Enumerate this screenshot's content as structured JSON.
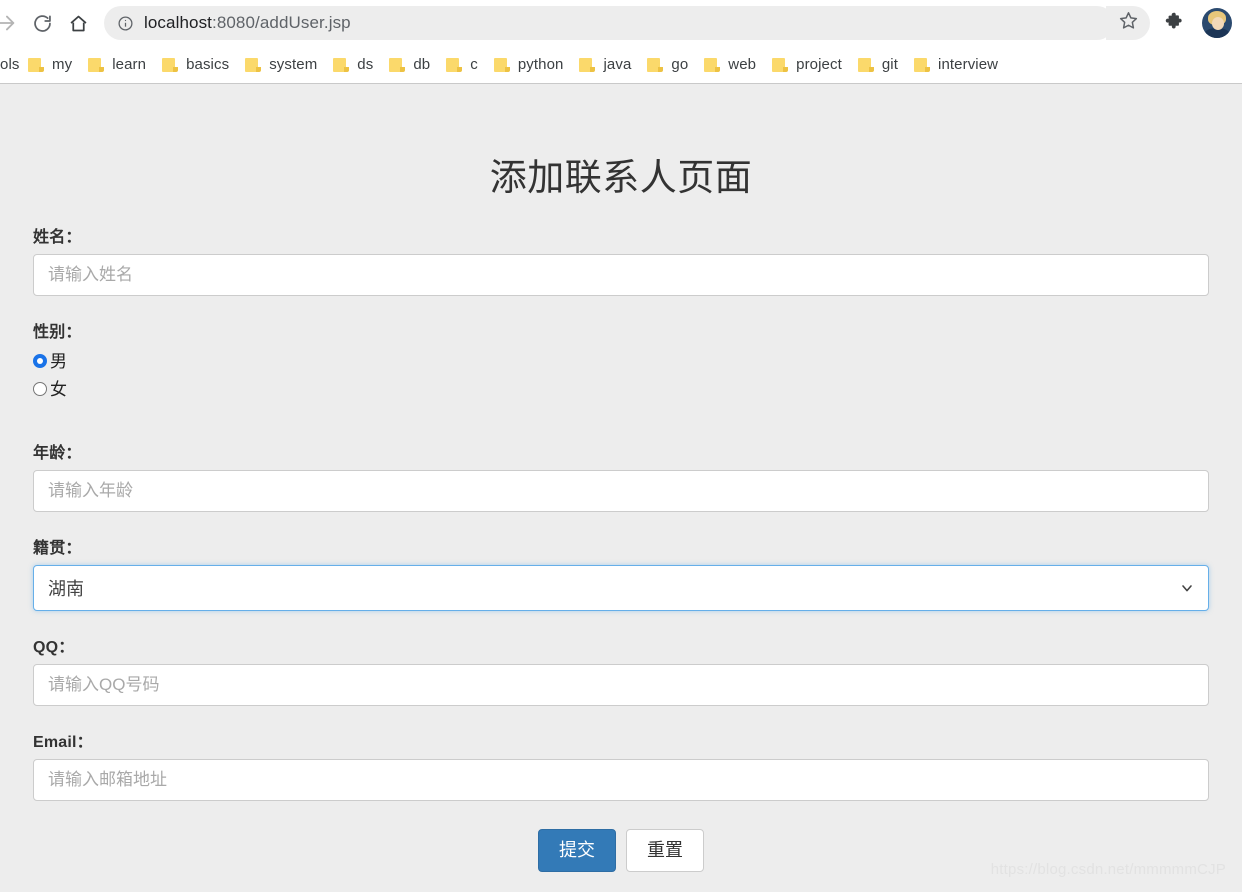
{
  "browser": {
    "nav": {
      "forward_icon": "arrow-forward-icon",
      "reload_icon": "reload-icon",
      "home_icon": "home-icon"
    },
    "omnibox": {
      "info_icon": "info-circle-icon",
      "url_host": "localhost",
      "url_rest": ":8080/addUser.jsp",
      "star_icon": "star-outline-icon"
    },
    "extensions_icon": "puzzle-piece-icon",
    "profile_icon": "profile-avatar",
    "bookmarks": [
      {
        "label": "ols",
        "icon": "folder-icon"
      },
      {
        "label": "my",
        "icon": "folder-icon"
      },
      {
        "label": "learn",
        "icon": "folder-icon"
      },
      {
        "label": "basics",
        "icon": "folder-icon"
      },
      {
        "label": "system",
        "icon": "folder-icon"
      },
      {
        "label": "ds",
        "icon": "folder-icon"
      },
      {
        "label": "db",
        "icon": "folder-icon"
      },
      {
        "label": "c",
        "icon": "folder-icon"
      },
      {
        "label": "python",
        "icon": "folder-icon"
      },
      {
        "label": "java",
        "icon": "folder-icon"
      },
      {
        "label": "go",
        "icon": "folder-icon"
      },
      {
        "label": "web",
        "icon": "folder-icon"
      },
      {
        "label": "project",
        "icon": "folder-icon"
      },
      {
        "label": "git",
        "icon": "folder-icon"
      },
      {
        "label": "interview",
        "icon": "folder-icon"
      }
    ]
  },
  "page": {
    "title": "添加联系人页面",
    "fields": {
      "name": {
        "label": "姓名：",
        "placeholder": "请输入姓名",
        "value": ""
      },
      "gender": {
        "label": "性别：",
        "options": [
          {
            "label": "男",
            "checked": true
          },
          {
            "label": "女",
            "checked": false
          }
        ]
      },
      "age": {
        "label": "年龄：",
        "placeholder": "请输入年龄",
        "value": ""
      },
      "hometown": {
        "label": "籍贯：",
        "selected": "湖南",
        "arrow_icon": "chevron-down-icon"
      },
      "qq": {
        "label": "QQ：",
        "placeholder": "请输入QQ号码",
        "value": ""
      },
      "email": {
        "label": "Email：",
        "placeholder": "请输入邮箱地址",
        "value": ""
      }
    },
    "buttons": {
      "submit": "提交",
      "reset": "重置"
    },
    "watermark": "https://blog.csdn.net/mmmmmCJP",
    "colors": {
      "primary": "#337ab7",
      "focus_border": "#66afe9",
      "radio_checked": "#1a73e8",
      "page_bg": "#ededed"
    }
  }
}
